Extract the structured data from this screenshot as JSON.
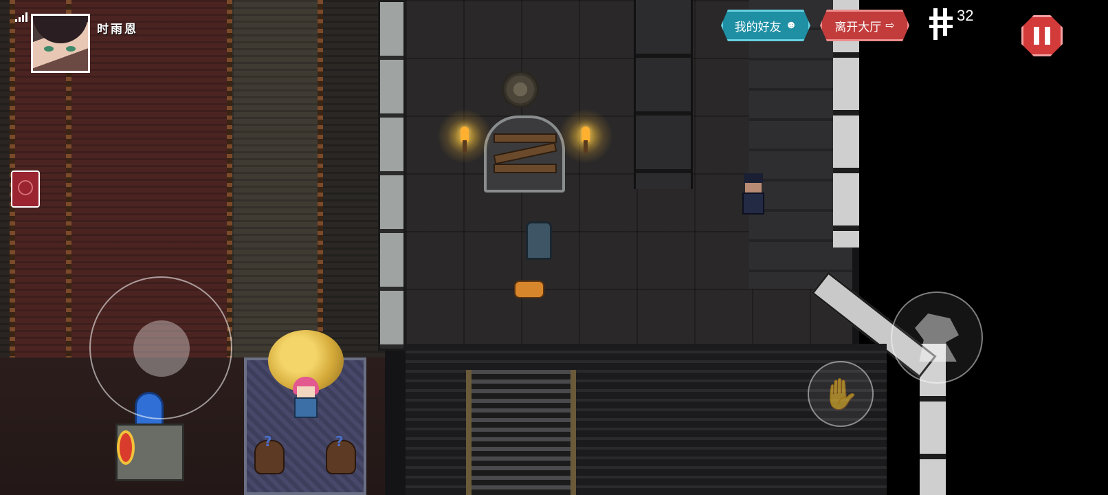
{
  "status_bar": {
    "signal_icon": "signal-bars-icon"
  },
  "player": {
    "name": "时雨恩",
    "avatar_icon": "anime-girl-avatar"
  },
  "side_card": {
    "icon": "red-card-icon"
  },
  "top_buttons": {
    "friends_label": "我的好友",
    "friends_icon": "friends-icon",
    "leave_label": "离开大厅",
    "leave_icon": "exit-arrow-icon"
  },
  "currency": {
    "count": "32",
    "icon": "coin-icon"
  },
  "controls": {
    "pause_icon": "pause-icon",
    "joystick_icon": "virtual-joystick",
    "interact_icon": "hand-icon",
    "attack_icon": "weapon-icon"
  },
  "colors": {
    "friends_button": "#1f8fa4",
    "leave_button": "#c23c3c",
    "pause_button": "#d33b3b"
  }
}
